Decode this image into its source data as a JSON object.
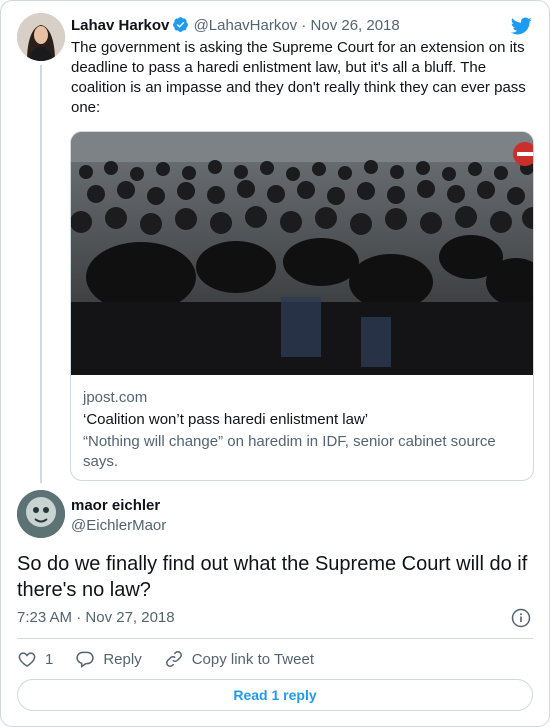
{
  "parent": {
    "name": "Lahav Harkov",
    "handle": "@LahavHarkov",
    "date": "Nov 26, 2018",
    "separator": " · ",
    "text": "The government is asking the Supreme Court for an extension on its deadline to pass a haredi enlistment law, but it's all a bluff. The coalition is an impasse and they don't really think they can ever pass one:",
    "link": {
      "domain": "jpost.com",
      "title": "‘Coalition won’t pass haredi enlistment law’",
      "description": "“Nothing will change” on haredim in IDF, senior cabinet source says."
    }
  },
  "reply": {
    "name": "maor eichler",
    "handle": "@EichlerMaor",
    "text": "So do we finally find out what the Supreme Court will do if there's no law?",
    "time": "7:23 AM",
    "date": "Nov 27, 2018",
    "separator": " · "
  },
  "actions": {
    "like_count": "1",
    "reply_label": "Reply",
    "copy_label": "Copy link to Tweet"
  },
  "read_button_label": "Read 1 reply",
  "colors": {
    "accent": "#1d9bf0",
    "muted": "#536471",
    "border": "#cfd9de",
    "text": "#0f1419"
  }
}
